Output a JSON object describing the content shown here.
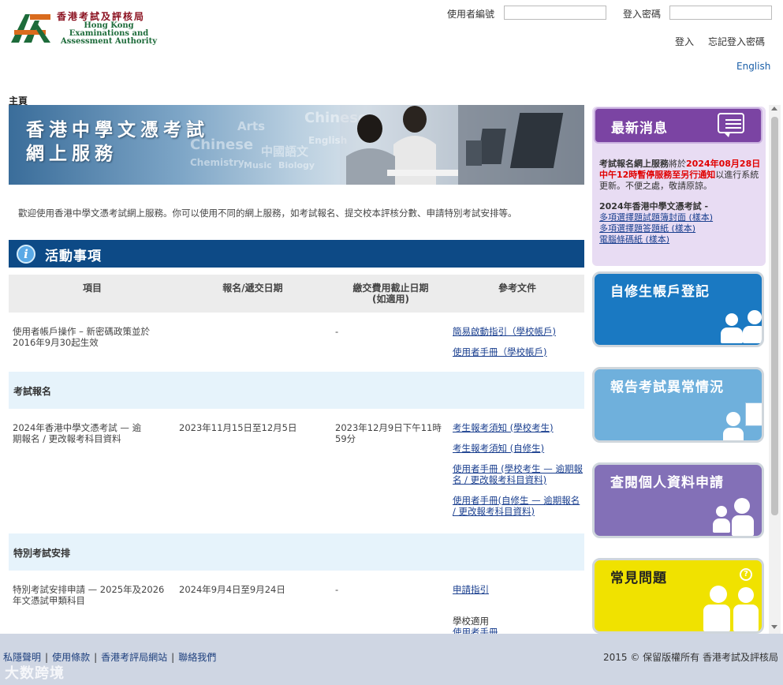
{
  "header": {
    "logo_zh": "香港考試及評核局",
    "logo_en": "Hong Kong Examinations and Assessment Authority",
    "login": {
      "user_id_label": "使用者編號",
      "password_label": "登入密碼",
      "login_link": "登入",
      "forgot_link": "忘記登入密碼"
    },
    "language_link": "English"
  },
  "breadcrumb": "主頁",
  "banner": {
    "title_line1": "香港中學文憑考試",
    "title_line2": "網上服務",
    "bg_words": [
      "Chinese",
      "Arts",
      "Chemistry",
      "Music",
      "Biology",
      "中國語文",
      "English"
    ]
  },
  "welcome_text": "歡迎使用香港中學文憑考試網上服務。你可以使用不同的網上服務，如考試報名、提交校本評核分數、申請特別考試安排等。",
  "activity": {
    "title": "活動事項",
    "headers": [
      "項目",
      "報名/遞交日期",
      "繳交費用截止日期\n(如適用)",
      "參考文件"
    ],
    "rows": [
      {
        "item": "使用者帳戶操作 – 新密碼政策並於2016年9月30起生效",
        "date": "",
        "fee_deadline": "-",
        "docs": [
          "簡易啟動指引（學校帳戶)",
          "使用者手冊（學校帳戶)"
        ]
      }
    ],
    "sections": [
      {
        "title": "考試報名",
        "item": "2024年香港中學文憑考試 — 逾期報名 / 更改報考科目資料",
        "date": "2023年11月15日至12月5日",
        "fee_deadline": "2023年12月9日下午11時59分",
        "docs": [
          "考生報考須知 (學校考生)",
          "考生報考須知 (自修生)",
          "使用者手冊 (學校考生 — 逾期報名 / 更改報考科目資料)",
          "使用者手冊(自修生 — 逾期報名 / 更改報考科目資料)"
        ]
      },
      {
        "title": "特別考試安排",
        "item": "特別考試安排申請 — 2025年及2026年文憑試甲類科目",
        "date": "2024年9月4日至9月24日",
        "fee_deadline": "-",
        "docs": [
          "申請指引"
        ],
        "extra_label": "學校適用",
        "extra_doc": "使用者手冊"
      }
    ]
  },
  "sidebar": {
    "news": {
      "title": "最新消息",
      "p1_bold": "考試報名網上服務",
      "p1_normal1": "將於",
      "p1_red": "2024年08月28日中午12時暫停服務至另行通知",
      "p1_normal2": "以進行系統更新。不便之處，敬請原諒。",
      "p2_bold": "2024年香港中學文憑考試 -",
      "links": [
        "多項選擇題試題簿封面 (樣本)",
        "多項選擇題答題紙 (樣本)",
        "電腦條碼紙 (樣本)"
      ]
    },
    "promos": [
      {
        "title": "自修生帳戶登記",
        "color": "#1a79c2"
      },
      {
        "title": "報告考試異常情況",
        "color": "#6fb0dc"
      },
      {
        "title": "查閱個人資料申請",
        "color": "#8370b7"
      },
      {
        "title": "常見問題",
        "color": "#f0e200"
      }
    ]
  },
  "footer": {
    "links": [
      "私隱聲明",
      "使用條款",
      "香港考評局網站",
      "聯絡我們"
    ],
    "copyright": "2015 © 保留版權所有 香港考試及評核局",
    "watermark": "大数跨境"
  }
}
